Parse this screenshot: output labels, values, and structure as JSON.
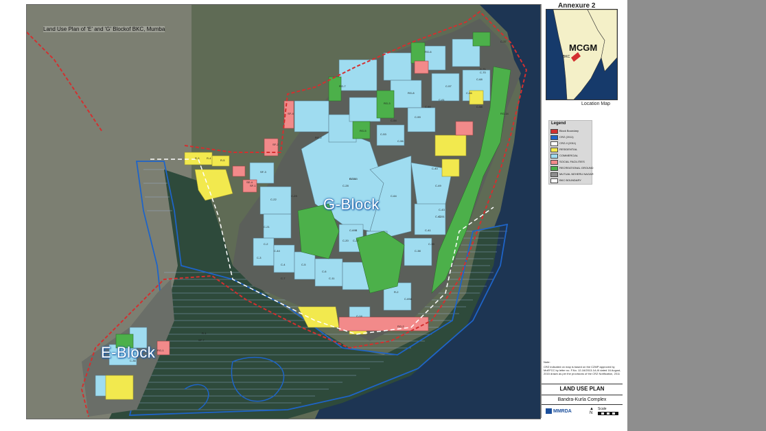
{
  "map": {
    "title": "Land Use Plan of 'E' and 'G' Blockof BKC, Mumba",
    "block_labels": {
      "g_block": "G-Block",
      "e_block": "E-Block"
    },
    "plot_labels": [
      "C-78",
      "C-64",
      "C-49",
      "C-57",
      "C-58",
      "C-56",
      "C-53",
      "C-54",
      "C-51",
      "C-59",
      "C-60",
      "C-61",
      "C-66",
      "C-68",
      "C-70",
      "C-71",
      "RG-3",
      "RG-5",
      "RG-6",
      "RG-7",
      "RG-8",
      "RG-2",
      "RG-14",
      "SF-3",
      "SF-1",
      "SF-2",
      "SF-4",
      "SE-4",
      "R-3",
      "R-4",
      "R-5",
      "C-21",
      "C-22",
      "C-23",
      "C-27",
      "C-28",
      "C-38",
      "C-39",
      "C-40",
      "C-41",
      "C-42",
      "C-43",
      "C-44",
      "C-2",
      "C-3",
      "C-4",
      "C-5",
      "C-6",
      "C-7",
      "C-11",
      "C-14",
      "C-20",
      "C-36",
      "RG-1",
      "RG-2",
      "SF-7",
      "R-1",
      "R-2",
      "C-69A",
      "C-69B",
      "C-37",
      "RG-15"
    ],
    "colors": {
      "block_boundary": "#d32f2f",
      "crz": "#1e64c8",
      "residential": "#f2e94e",
      "commercial": "#9fdcf0",
      "social": "#f28a8a",
      "recreational": "#4cb04a",
      "mutual": "#8e8e8e",
      "bkc_boundary": "#ffffff",
      "water": "#1d3553",
      "mangrove": "#2e4a3b"
    }
  },
  "panel": {
    "annexure": "Annexure 2",
    "location_map": {
      "region_label": "MCGM",
      "small_label": "BKC",
      "title": "Location Map"
    },
    "legend": {
      "title": "Legend",
      "items": [
        {
          "label": "Block Boundary",
          "color": "#d32f2f"
        },
        {
          "label": "CRZ (2011)",
          "color": "#1e64c8"
        },
        {
          "label": "CRZ-II (2011)",
          "color": "#ffffff"
        },
        {
          "label": "RESIDENTIAL",
          "color": "#f2e94e"
        },
        {
          "label": "COMMERCIAL",
          "color": "#9fdcf0"
        },
        {
          "label": "SOCIAL FACILITIES",
          "color": "#f28a8a"
        },
        {
          "label": "RECREATIONAL GROUND",
          "color": "#4cb04a"
        },
        {
          "label": "MUTUAL NEHERU NAGAR",
          "color": "#8e8e8e"
        },
        {
          "label": "BKC BOUNDARY",
          "color": "#ffffff"
        }
      ]
    },
    "note_head": "Note:",
    "note": "CRZ indicated on map is based on the CZMP approved by MoEFCC by letter no. F.No. 12-16/2013-1A-III dated 16 August, 2015 drawn as per the provisions of the CRZ Notification, 2011",
    "title_block": {
      "title": "LAND USE PLAN",
      "subtitle": "Bandra-Kurla Complex",
      "logo": "MMRDA",
      "scale": "Scale",
      "north": "N"
    }
  }
}
